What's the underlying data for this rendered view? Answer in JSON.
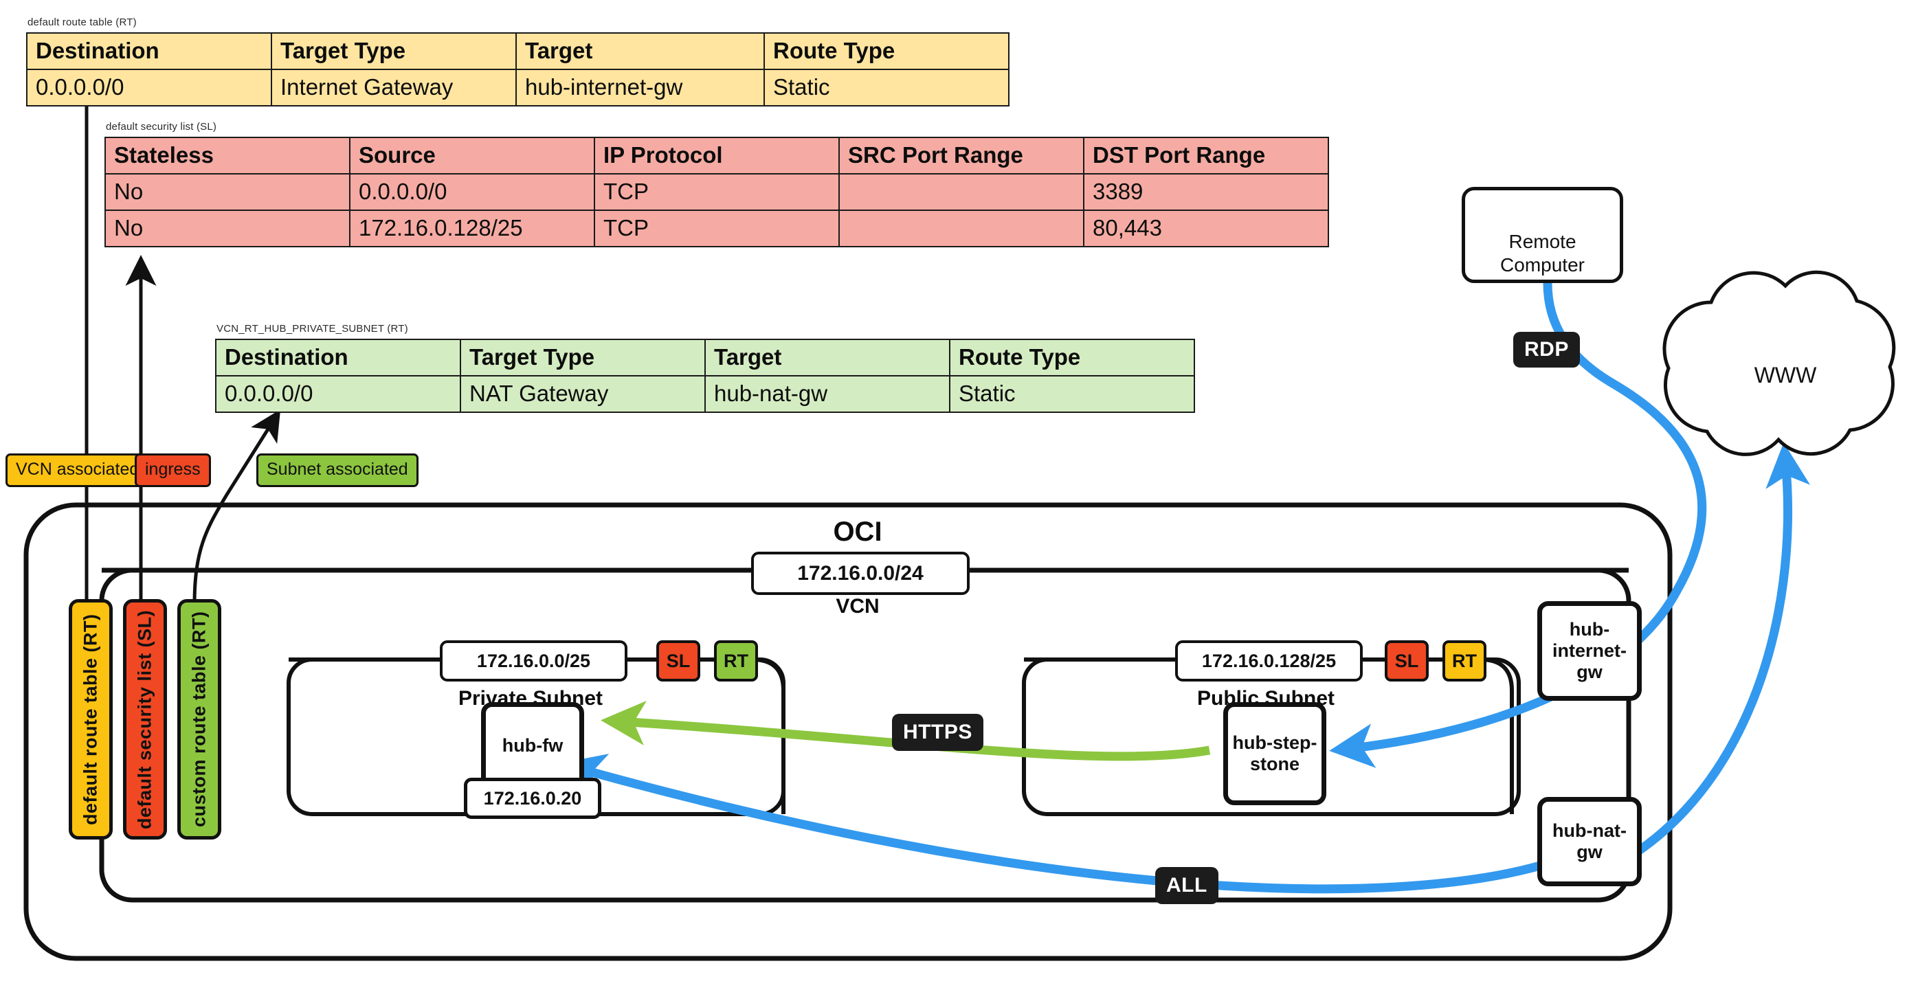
{
  "tables": [
    {
      "id": "default-route-table",
      "caption": "default route table (RT)",
      "theme": "yellow",
      "headers": [
        "Destination",
        "Target Type",
        "Target",
        "Route Type"
      ],
      "rows": [
        [
          "0.0.0.0/0",
          "Internet Gateway",
          "hub-internet-gw",
          "Static"
        ]
      ]
    },
    {
      "id": "default-security-list",
      "caption": "default security list (SL)",
      "theme": "red",
      "headers": [
        "Stateless",
        "Source",
        "IP Protocol",
        "SRC Port Range",
        "DST Port Range"
      ],
      "rows": [
        [
          "No",
          "0.0.0.0/0",
          "TCP",
          "",
          "3389"
        ],
        [
          "No",
          "172.16.0.128/25",
          "TCP",
          "",
          "80,443"
        ]
      ]
    },
    {
      "id": "custom-route-table",
      "caption": "VCN_RT_HUB_PRIVATE_SUBNET (RT)",
      "theme": "green",
      "headers": [
        "Destination",
        "Target Type",
        "Target",
        "Route Type"
      ],
      "rows": [
        [
          "0.0.0.0/0",
          "NAT Gateway",
          "hub-nat-gw",
          "Static"
        ]
      ]
    }
  ],
  "leader_pills": [
    {
      "id": "vcn-associated",
      "label": "VCN associated",
      "color": "#fcc211"
    },
    {
      "id": "ingress",
      "label": "ingress",
      "color": "#ef4823"
    },
    {
      "id": "subnet-associated",
      "label": "Subnet associated",
      "color": "#8cc63f"
    }
  ],
  "side_tags": [
    {
      "id": "default-route-table-tag",
      "label": "default route table (RT)",
      "color": "#fcc211"
    },
    {
      "id": "default-security-list-tag",
      "label": "default security list (SL)",
      "color": "#ef4823"
    },
    {
      "id": "custom-route-table-tag",
      "label": "custom route table (RT)",
      "color": "#8cc63f"
    }
  ],
  "cloud": {
    "oci_title": "OCI",
    "vcn_cidr": "172.16.0.0/24",
    "vcn_title": "VCN"
  },
  "subnets": [
    {
      "id": "private-subnet",
      "cidr": "172.16.0.0/25",
      "title": "Private Subnet",
      "badges": [
        {
          "id": "sl-badge-private",
          "label": "SL",
          "color": "#ef4823"
        },
        {
          "id": "rt-badge-private",
          "label": "RT",
          "color": "#8cc63f"
        }
      ],
      "node": {
        "id": "hub-fw",
        "label": "hub-fw",
        "ip": "172.16.0.20"
      }
    },
    {
      "id": "public-subnet",
      "cidr": "172.16.0.128/25",
      "title": "Public Subnet",
      "badges": [
        {
          "id": "sl-badge-public",
          "label": "SL",
          "color": "#ef4823"
        },
        {
          "id": "rt-badge-public",
          "label": "RT",
          "color": "#fcc211"
        }
      ],
      "node": {
        "id": "hub-step-stone",
        "label": "hub-step-stone",
        "line1": "hub-step-",
        "line2": "stone"
      }
    }
  ],
  "gateways": [
    {
      "id": "hub-internet-gw",
      "line1": "hub-",
      "line2": "internet-",
      "line3": "gw"
    },
    {
      "id": "hub-nat-gw",
      "line1": "hub-nat-",
      "line2": "gw"
    }
  ],
  "remote": {
    "id": "remote-computer",
    "line1": "Remote",
    "line2": "Computer",
    "laptop_icon": "laptop-icon",
    "user_icon": "user-icon"
  },
  "internet": {
    "id": "www-cloud",
    "label": "WWW"
  },
  "flows": [
    {
      "id": "rdp-flow",
      "label": "RDP",
      "color": "#3399ee"
    },
    {
      "id": "https-flow",
      "label": "HTTPS",
      "color": "#8cc63f"
    },
    {
      "id": "all-flow",
      "label": "ALL",
      "color": "#3399ee"
    }
  ],
  "colors": {
    "stroke": "#111111",
    "blue": "#3399ee",
    "green": "#8cc63f",
    "yellow": "#fcc211",
    "red": "#ef4823",
    "table_yellow": "#ffe5a0",
    "table_red": "#f5aba3",
    "table_green": "#d4ecc2"
  }
}
